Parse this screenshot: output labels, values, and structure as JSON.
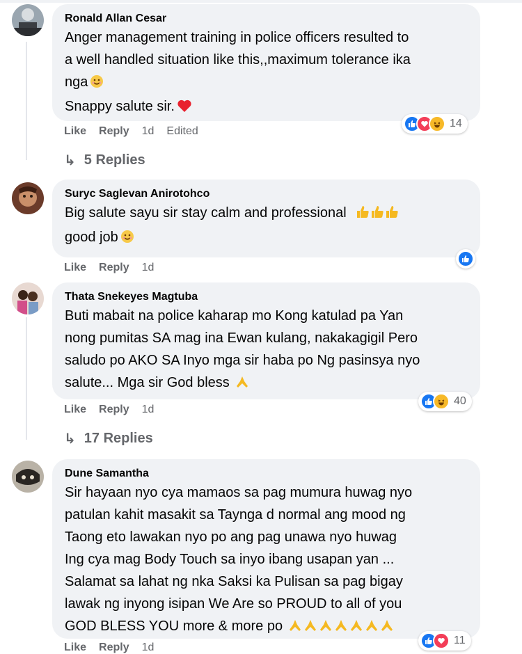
{
  "comments": [
    {
      "author": "Ronald Allan Cesar",
      "lines": [
        "Anger management training in police officers resulted to",
        "a well handled situation like this,,maximum tolerance ika",
        "nga",
        "Snappy salute sir."
      ],
      "actions": {
        "like": "Like",
        "reply": "Reply",
        "time": "1d",
        "edited": "Edited"
      },
      "reactions": {
        "icons": [
          "like-icon",
          "love-icon",
          "haha-icon"
        ],
        "count": "14"
      },
      "replies_label": "5 Replies"
    },
    {
      "author": "Suryc Saglevan Anirotohco",
      "lines": [
        "Big salute sayu sir stay calm and professional",
        "good job"
      ],
      "actions": {
        "like": "Like",
        "reply": "Reply",
        "time": "1d"
      },
      "reactions": {
        "icons": [
          "like-icon"
        ]
      }
    },
    {
      "author": "Thata Snekeyes Magtuba",
      "lines": [
        "Buti mabait na police kaharap mo Kong katulad pa Yan",
        "nong pumitas SA mag ina Ewan kulang, nakakagigil Pero",
        "saludo po AKO SA Inyo mga sir haba po Ng pasinsya nyo",
        "salute... Mga sir God bless"
      ],
      "actions": {
        "like": "Like",
        "reply": "Reply",
        "time": "1d"
      },
      "reactions": {
        "icons": [
          "like-icon",
          "haha-icon"
        ],
        "count": "40"
      },
      "replies_label": "17 Replies"
    },
    {
      "author": "Dune Samantha",
      "lines": [
        "Sir hayaan nyo cya mamaos sa pag mumura huwag nyo",
        "patulan kahit masakit sa Taynga d normal ang mood ng",
        "Taong eto lawakan nyo po ang pag unawa nyo huwag",
        "Ing cya mag Body Touch sa inyo ibang usapan yan ...",
        "Salamat sa lahat ng nka Saksi ka Pulisan sa pag bigay",
        "lawak ng inyong isipan We Are so PROUD to all of you",
        "GOD BLESS YOU more & more po"
      ],
      "actions": {
        "like": "Like",
        "reply": "Reply",
        "time": "1d"
      },
      "reactions": {
        "icons": [
          "like-icon",
          "love-icon"
        ],
        "count": "11"
      }
    }
  ],
  "colors": {
    "bubble": "#f0f2f5",
    "meta_text": "#65676b",
    "like_blue": "#1877f2",
    "love_red": "#f33e58",
    "haha_yellow": "#f7b928"
  }
}
